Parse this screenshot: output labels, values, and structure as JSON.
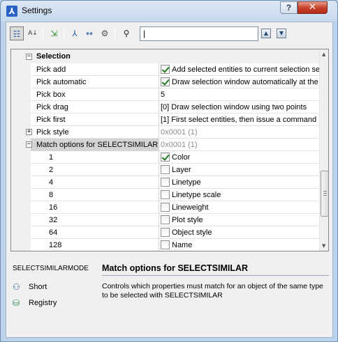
{
  "window": {
    "title": "Settings",
    "help_label": "?",
    "close_label": "✕"
  },
  "toolbar": {
    "search_value": "",
    "search_caret": "|",
    "prev_label": "▲",
    "next_label": "▼",
    "buttons": [
      {
        "name": "categorized-view-icon",
        "glyph": "☷"
      },
      {
        "name": "sort-alphabetical-icon",
        "glyph": "A↓"
      },
      {
        "name": "export-icon",
        "glyph": "⇲"
      },
      {
        "name": "app-settings-icon",
        "glyph": "⅄"
      },
      {
        "name": "column-width-icon",
        "glyph": "↔"
      },
      {
        "name": "settings-gear-icon",
        "glyph": "⚙"
      },
      {
        "name": "find-binoculars-icon",
        "glyph": "⚲"
      }
    ]
  },
  "grid": {
    "category": {
      "label": "Selection",
      "expander": "−"
    },
    "rows": [
      {
        "name": "Pick add",
        "checkbox": true,
        "checked": true,
        "value": "Add selected entities to current selection set"
      },
      {
        "name": "Pick automatic",
        "checkbox": true,
        "checked": true,
        "value": "Draw selection window automatically at the"
      },
      {
        "name": "Pick box",
        "checkbox": false,
        "value": "5"
      },
      {
        "name": "Pick drag",
        "checkbox": false,
        "value": "[0] Draw selection window using two points"
      },
      {
        "name": "Pick first",
        "checkbox": false,
        "value": "[1] First select entities, then issue a command"
      },
      {
        "name": "Pick style",
        "expander": "+",
        "value": "0x0001 (1)",
        "grey": true
      },
      {
        "name": "Match options for SELECTSIMILAR",
        "expander": "−",
        "value": "0x0001 (1)",
        "grey": true,
        "selected": true
      }
    ],
    "subrows": [
      {
        "name": "1",
        "checked": true,
        "value": "Color"
      },
      {
        "name": "2",
        "checked": false,
        "value": "Layer"
      },
      {
        "name": "4",
        "checked": false,
        "value": "Linetype"
      },
      {
        "name": "8",
        "checked": false,
        "value": "Linetype scale"
      },
      {
        "name": "16",
        "checked": false,
        "value": "Lineweight"
      },
      {
        "name": "32",
        "checked": false,
        "value": "Plot style"
      },
      {
        "name": "64",
        "checked": false,
        "value": "Object style"
      },
      {
        "name": "128",
        "checked": false,
        "value": "Name"
      }
    ]
  },
  "info": {
    "variable_name": "SELECTSIMILARMODE",
    "short_label": "Short",
    "registry_label": "Registry",
    "title": "Match options for SELECTSIMILAR",
    "description": "Controls which properties must match for an object of the same type to be selected with SELECTSIMILAR"
  }
}
